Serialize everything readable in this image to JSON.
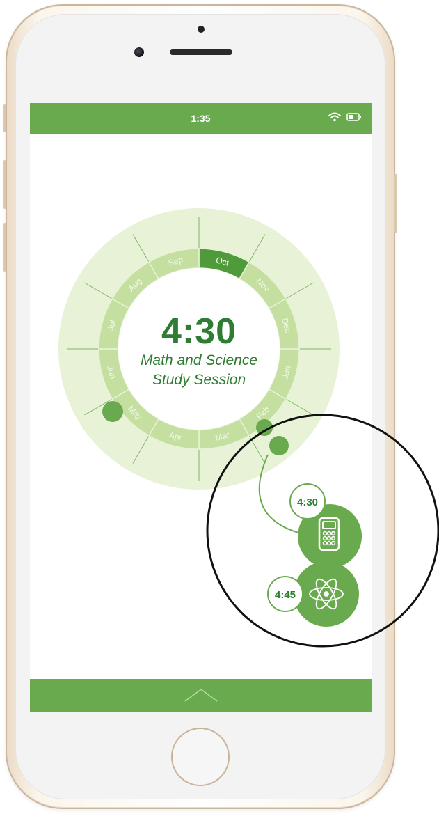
{
  "status_bar": {
    "time": "1:35",
    "icons": [
      "wifi-icon",
      "battery-icon"
    ]
  },
  "wheel": {
    "months": [
      "Oct",
      "Nov",
      "Dec",
      "Jan",
      "Feb",
      "Mar",
      "Apr",
      "May",
      "Jun",
      "Jul",
      "Aug",
      "Sep"
    ],
    "selected_month": "Oct",
    "center_time": "4:30",
    "session_title_line1": "Math and Science",
    "session_title_line2": "Study Session"
  },
  "events": [
    {
      "time": "4:30",
      "icon": "calculator-icon"
    },
    {
      "time": "4:45",
      "icon": "atom-icon"
    }
  ],
  "bottom_bar": {
    "icon": "chevron-up-icon"
  },
  "colors": {
    "primary_green": "#6aaa4f",
    "dark_green": "#2e7d32",
    "ring_green": "#c5dfa1",
    "outer_ring": "#e8f2d6"
  }
}
